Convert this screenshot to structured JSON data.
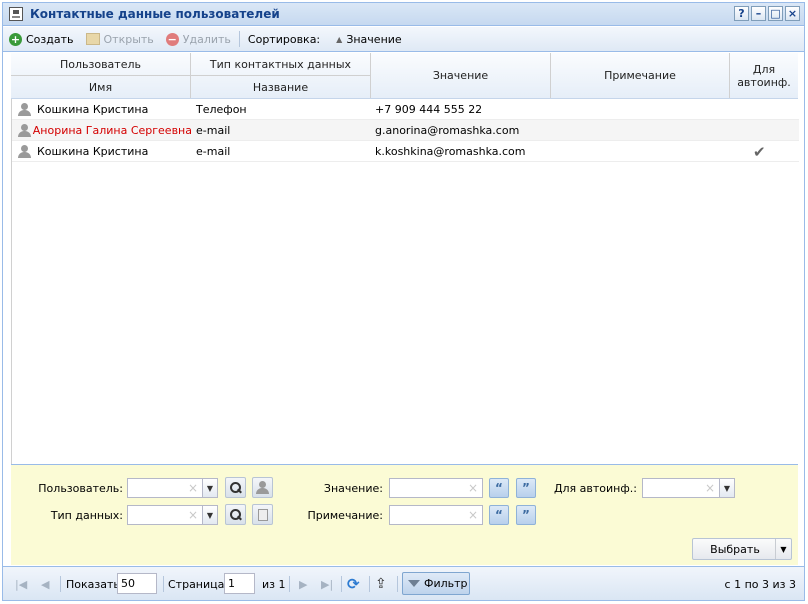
{
  "window": {
    "title": "Контактные данные пользователей",
    "buttons": [
      "?",
      "–",
      "□",
      "×"
    ]
  },
  "toolbar": {
    "create": "Создать",
    "open": "Открыть",
    "delete": "Удалить",
    "sort_label": "Сортировка:",
    "sort_value": "Значение"
  },
  "grid": {
    "headers": {
      "user_group": "Пользователь",
      "user_name": "Имя",
      "type_group": "Тип контактных данных",
      "type_name": "Название",
      "value": "Значение",
      "note": "Примечание",
      "auto": "Для автоинф."
    },
    "rows": [
      {
        "name": "Кошкина Кристина",
        "type": "Телефон",
        "value": "+7 909 444 555 22",
        "note": "",
        "auto": "",
        "highlight": false
      },
      {
        "name": "Анорина Галина Сергеевна",
        "type": "e-mail",
        "value": "g.anorina@romashka.com",
        "note": "",
        "auto": "",
        "highlight": true
      },
      {
        "name": "Кошкина Кристина",
        "type": "e-mail",
        "value": "k.koshkina@romashka.com",
        "note": "",
        "auto": "✔",
        "highlight": false
      }
    ]
  },
  "filter": {
    "user_label": "Пользователь:",
    "type_label": "Тип данных:",
    "value_label": "Значение:",
    "note_label": "Примечание:",
    "auto_label": "Для автоинф.:",
    "clear_glyph": "×",
    "select_button": "Выбрать"
  },
  "pager": {
    "show_label": "Показать",
    "page_size": "50",
    "page_label": "Страница",
    "page": "1",
    "of_label": "из 1",
    "filter_button": "Фильтр",
    "summary": "с 1 по 3 из 3"
  },
  "colors": {
    "title_text": "#15428b",
    "highlight_row_text": "#d40000",
    "filter_panel_bg": "#fbfbd5",
    "create_icon": "#3a9a3a"
  }
}
